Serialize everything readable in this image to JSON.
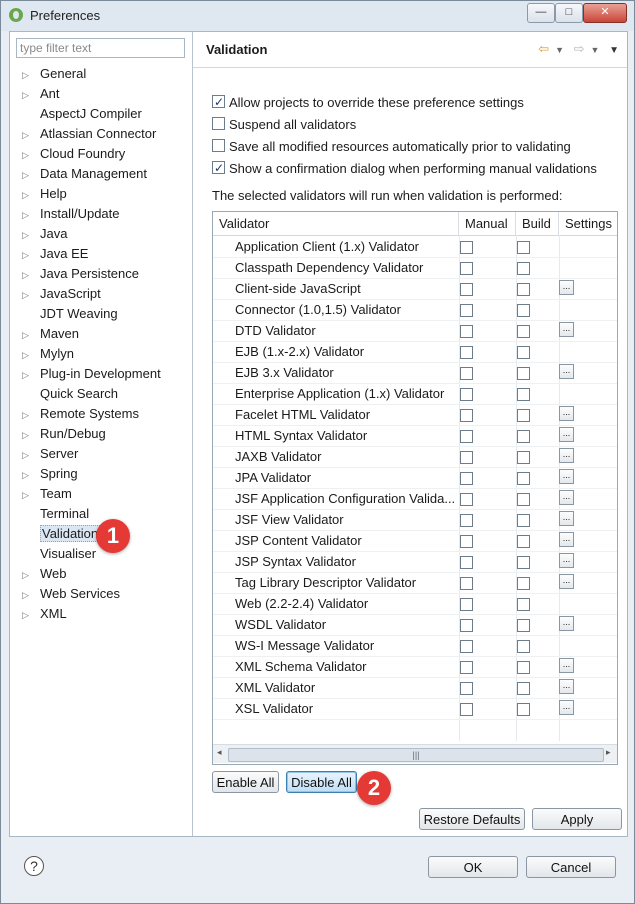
{
  "window": {
    "title": "Preferences",
    "minimize_glyph": "—",
    "maximize_glyph": "□",
    "close_glyph": "✕"
  },
  "sidebar": {
    "filter_placeholder": "type filter text",
    "items": [
      {
        "label": "General",
        "expandable": true
      },
      {
        "label": "Ant",
        "expandable": true
      },
      {
        "label": "AspectJ Compiler",
        "expandable": false
      },
      {
        "label": "Atlassian Connector",
        "expandable": true
      },
      {
        "label": "Cloud Foundry",
        "expandable": true
      },
      {
        "label": "Data Management",
        "expandable": true
      },
      {
        "label": "Help",
        "expandable": true
      },
      {
        "label": "Install/Update",
        "expandable": true
      },
      {
        "label": "Java",
        "expandable": true
      },
      {
        "label": "Java EE",
        "expandable": true
      },
      {
        "label": "Java Persistence",
        "expandable": true
      },
      {
        "label": "JavaScript",
        "expandable": true
      },
      {
        "label": "JDT Weaving",
        "expandable": false
      },
      {
        "label": "Maven",
        "expandable": true
      },
      {
        "label": "Mylyn",
        "expandable": true
      },
      {
        "label": "Plug-in Development",
        "expandable": true
      },
      {
        "label": "Quick Search",
        "expandable": false
      },
      {
        "label": "Remote Systems",
        "expandable": true
      },
      {
        "label": "Run/Debug",
        "expandable": true
      },
      {
        "label": "Server",
        "expandable": true
      },
      {
        "label": "Spring",
        "expandable": true
      },
      {
        "label": "Team",
        "expandable": true
      },
      {
        "label": "Terminal",
        "expandable": false
      },
      {
        "label": "Validation",
        "expandable": false,
        "selected": true
      },
      {
        "label": "Visualiser",
        "expandable": false
      },
      {
        "label": "Web",
        "expandable": true
      },
      {
        "label": "Web Services",
        "expandable": true
      },
      {
        "label": "XML",
        "expandable": true
      }
    ]
  },
  "page": {
    "title": "Validation",
    "nav_icons": {
      "back": "back-arrow-icon",
      "forward": "forward-arrow-icon",
      "menu": "view-menu-icon"
    },
    "options": [
      {
        "label": "Allow projects to override these preference settings",
        "checked": true
      },
      {
        "label": "Suspend all validators",
        "checked": false
      },
      {
        "label": "Save all modified resources automatically prior to validating",
        "checked": false
      },
      {
        "label": "Show a confirmation dialog when performing manual validations",
        "checked": true
      }
    ],
    "info": "The selected validators will run when validation is performed:",
    "table": {
      "columns": [
        "Validator",
        "Manual",
        "Build",
        "Settings"
      ],
      "rows": [
        {
          "name": "Application Client (1.x) Validator",
          "settings": false
        },
        {
          "name": "Classpath Dependency Validator",
          "settings": false
        },
        {
          "name": "Client-side JavaScript",
          "settings": true
        },
        {
          "name": "Connector (1.0,1.5) Validator",
          "settings": false
        },
        {
          "name": "DTD Validator",
          "settings": true
        },
        {
          "name": "EJB (1.x-2.x) Validator",
          "settings": false
        },
        {
          "name": "EJB 3.x Validator",
          "settings": true
        },
        {
          "name": "Enterprise Application (1.x) Validator",
          "settings": false
        },
        {
          "name": "Facelet HTML Validator",
          "settings": true
        },
        {
          "name": "HTML Syntax Validator",
          "settings": true
        },
        {
          "name": "JAXB Validator",
          "settings": true
        },
        {
          "name": "JPA Validator",
          "settings": true
        },
        {
          "name": "JSF Application Configuration Valida...",
          "settings": true
        },
        {
          "name": "JSF View Validator",
          "settings": true
        },
        {
          "name": "JSP Content Validator",
          "settings": true
        },
        {
          "name": "JSP Syntax Validator",
          "settings": true
        },
        {
          "name": "Tag Library Descriptor Validator",
          "settings": true
        },
        {
          "name": "Web (2.2-2.4) Validator",
          "settings": false
        },
        {
          "name": "WSDL Validator",
          "settings": true
        },
        {
          "name": "WS-I Message Validator",
          "settings": false
        },
        {
          "name": "XML Schema Validator",
          "settings": true
        },
        {
          "name": "XML Validator",
          "settings": true
        },
        {
          "name": "XSL Validator",
          "settings": true
        }
      ],
      "settings_glyph": "...",
      "scroll_left": "◂",
      "scroll_right": "▸",
      "scroll_grip": "|||"
    },
    "enable_all": "Enable All",
    "disable_all": "Disable All",
    "restore_defaults": "Restore Defaults",
    "apply": "Apply"
  },
  "footer": {
    "help": "?",
    "ok": "OK",
    "cancel": "Cancel"
  },
  "annotations": {
    "marker1": "1",
    "marker2": "2",
    "marker_color": "#e53935"
  }
}
